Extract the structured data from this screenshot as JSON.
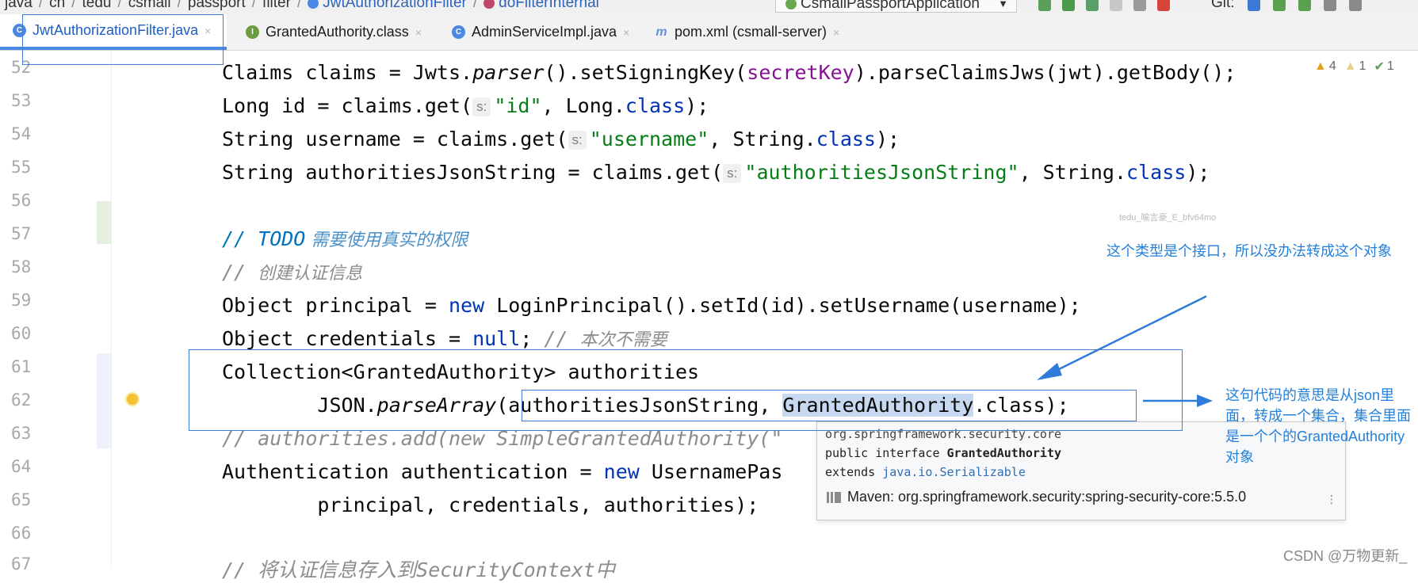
{
  "breadcrumb": {
    "items": [
      "java",
      "cn",
      "tedu",
      "csmall",
      "passport",
      "filter",
      "JwtAuthorizationFilter",
      "doFilterInternal"
    ]
  },
  "toolbar": {
    "run_config": "CsmallPassportApplication",
    "git_label": "Git:"
  },
  "tabs": [
    {
      "label": "JwtAuthorizationFilter.java",
      "icon": "java-class-icon",
      "active": true
    },
    {
      "label": "GrantedAuthority.class",
      "icon": "interface-icon",
      "active": false
    },
    {
      "label": "AdminServiceImpl.java",
      "icon": "java-class-icon",
      "active": false
    },
    {
      "label": "pom.xml (csmall-server)",
      "icon": "maven-icon",
      "active": false
    }
  ],
  "inspections": {
    "warnings": "4",
    "weak_warnings": "1",
    "checks": "1"
  },
  "line_numbers": [
    "52",
    "53",
    "54",
    "55",
    "56",
    "57",
    "58",
    "59",
    "60",
    "61",
    "62",
    "63",
    "64",
    "65",
    "66",
    "67"
  ],
  "code": {
    "l52": {
      "a": "Claims claims = Jwts.",
      "b": "parser",
      "c": "().setSigningKey(",
      "d": "secretKey",
      "e": ").parseClaimsJws(jwt).getBody();"
    },
    "l53": {
      "a": "Long id = claims.get(",
      "hint": "s:",
      "str": "\"id\"",
      "b": ", Long.",
      "kw": "class",
      "c": ");"
    },
    "l54": {
      "a": "String username = claims.get(",
      "hint": "s:",
      "str": "\"username\"",
      "b": ", String.",
      "kw": "class",
      "c": ");"
    },
    "l55": {
      "a": "String authoritiesJsonString = claims.get(",
      "hint": "s:",
      "str": "\"authoritiesJsonString\"",
      "b": ", String.",
      "kw": "class",
      "c": ");"
    },
    "l57": {
      "slashes": "// ",
      "todo": "TODO",
      "text": " 需要使用真实的权限"
    },
    "l58": {
      "slashes": "// ",
      "text": "创建认证信息"
    },
    "l59": {
      "a": "Object principal = ",
      "kw": "new",
      "b": " LoginPrincipal().setId(id).setUsername(username);"
    },
    "l60": {
      "a": "Object credentials = ",
      "kw": "null",
      "b": "; ",
      "cm": "// ",
      "cjk": "本次不需要"
    },
    "l61": {
      "a": "Collection<GrantedAuthority> authorities"
    },
    "l62": {
      "a": "        JSON.",
      "b": "parseArray",
      "c": "(authoritiesJsonString, ",
      "sel": "GrantedAuthority",
      "d": ".class);"
    },
    "l63": {
      "a": "// authorities.add(new SimpleGrantedAuthority(\""
    },
    "l64": {
      "a": "Authentication authentication = ",
      "kw": "new",
      "b": " UsernamePas"
    },
    "l65": {
      "a": "        principal, credentials, authorities);"
    },
    "l67": {
      "a": "// 将认证信息存入到SecurityContext中"
    }
  },
  "popup": {
    "package": "org.springframework.security.core",
    "decl_a": "public interface ",
    "decl_b": "GrantedAuthority",
    "extends_a": "extends ",
    "extends_b": "java.io.Serializable",
    "maven": "Maven: org.springframework.security:spring-security-core:5.5.0"
  },
  "annotations": {
    "note_top": "这个类型是个接口，所以没办法转成这个对象",
    "note_right": "这句代码的意思是从json里面，转成一个集合，集合里面是一个个的GrantedAuthority对象",
    "watermark": "tedu_喻言豪_E_bfv64mo",
    "footer": "CSDN @万物更新_"
  },
  "colors": {
    "accent": "#4a88e4",
    "annotation": "#3f7fd6",
    "keyword": "#0033b3",
    "string": "#067d17",
    "field": "#871094"
  }
}
